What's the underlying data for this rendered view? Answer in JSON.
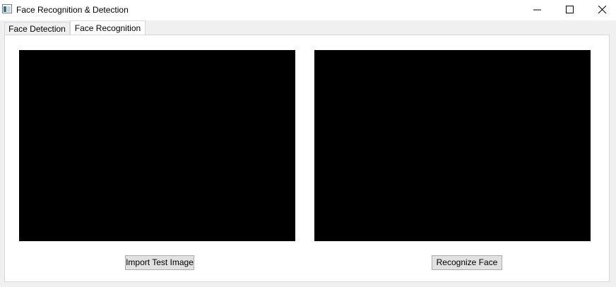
{
  "window": {
    "title": "Face Recognition & Detection"
  },
  "tabs": [
    {
      "label": "Face Detection",
      "selected": false
    },
    {
      "label": "Face Recognition",
      "selected": true
    }
  ],
  "panes": {
    "left_view": {
      "icon": "image-placeholder"
    },
    "right_view": {
      "icon": "image-placeholder"
    }
  },
  "buttons": {
    "import_label": "Import Test Image",
    "recognize_label": "Recognize Face"
  },
  "caption_icons": [
    "minimize-icon",
    "maximize-icon",
    "close-icon"
  ],
  "colors": {
    "view_background": "#000000",
    "window_background": "#f0f0f0",
    "pane_background": "#ffffff"
  }
}
